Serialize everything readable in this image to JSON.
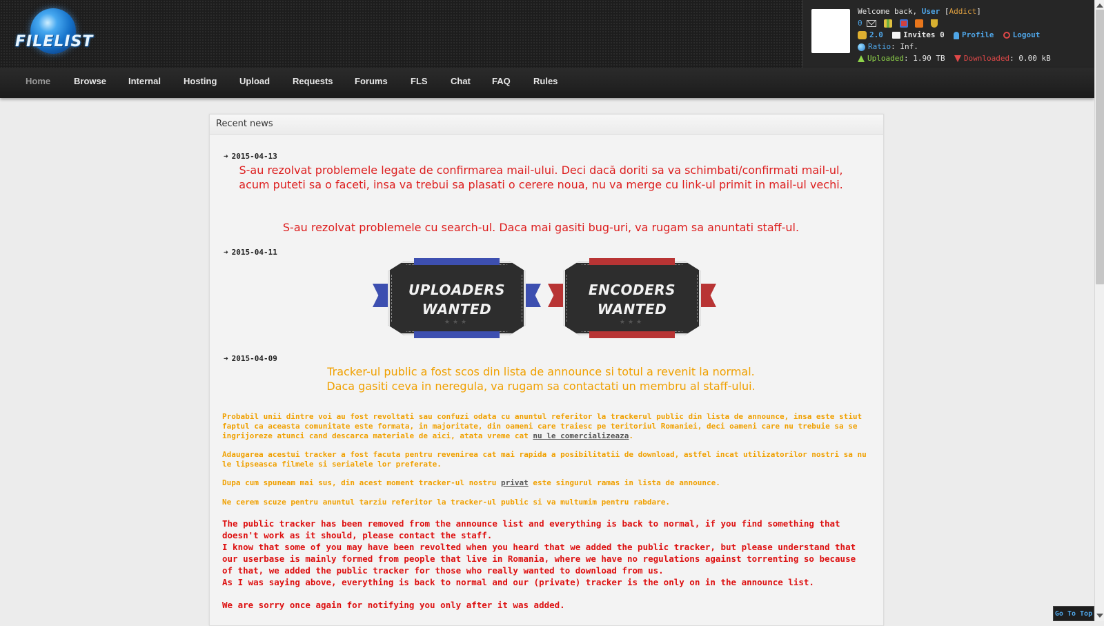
{
  "site": {
    "logo_text": "FILELIST"
  },
  "user": {
    "welcome": "Welcome back,",
    "name": "User",
    "class": "Addict",
    "messages_count": "0",
    "bonus": "2.0",
    "invites_label": "Invites 0",
    "profile_label": "Profile",
    "logout_label": "Logout",
    "ratio_label": "Ratio",
    "ratio_value": "Inf.",
    "uploaded_label": "Uploaded",
    "uploaded_value": "1.90 TB",
    "downloaded_label": "Downloaded",
    "downloaded_value": "0.00 kB"
  },
  "nav": {
    "items": [
      {
        "label": "Home",
        "active": true
      },
      {
        "label": "Browse"
      },
      {
        "label": "Internal"
      },
      {
        "label": "Hosting"
      },
      {
        "label": "Upload"
      },
      {
        "label": "Requests"
      },
      {
        "label": "Forums"
      },
      {
        "label": "FLS"
      },
      {
        "label": "Chat"
      },
      {
        "label": "FAQ"
      },
      {
        "label": "Rules"
      }
    ]
  },
  "news": {
    "title": "Recent news",
    "entries": [
      {
        "date": "2015-04-13",
        "text1": "S-au rezolvat problemele legate de confirmarea mail-ului. Deci dacă doriti sa va schimbati/confirmati mail-ul, acum puteti sa o faceti, insa va trebui sa plasati o cerere noua, nu va merge cu link-ul primit in mail-ul vechi.",
        "text2": "S-au rezolvat problemele cu search-ul. Daca mai gasiti bug-uri, va rugam sa anuntati staff-ul."
      },
      {
        "date": "2015-04-11",
        "banner1_line1": "UPLOADERS",
        "banner1_line2": "WANTED",
        "banner2_line1": "ENCODERS",
        "banner2_line2": "WANTED"
      },
      {
        "date": "2015-04-09",
        "headline1": "Tracker-ul public a fost scos din lista de announce si totul a revenit la normal.",
        "headline2": "Daca gasiti ceva in neregula, va rugam sa contactati un membru al staff-ului.",
        "p1": "Probabil unii dintre voi au fost revoltati sau confuzi odata cu anuntul referitor la trackerul public din lista de announce, insa este stiut faptul ca aceasta comunitate este formata, in majoritate, din oameni care traiesc pe teritoriul Romaniei, deci oameni care nu trebuie sa se ingrijoreze atunci cand descarca materiale de aici, atata vreme cat",
        "p1_link": "nu le comercializeaza",
        "p2": "Adaugarea acestui tracker a fost facuta pentru revenirea cat mai rapida a posibilitatii de download, astfel incat utilizatorilor nostri sa nu le lipseasca filmele si serialele lor preferate.",
        "p3_before": "Dupa cum spuneam mai sus, din acest moment tracker-ul nostru",
        "p3_link": "privat",
        "p3_after": "este singurul ramas in lista de announce.",
        "p4": "Ne cerem scuze pentru anuntul tarziu referitor la tracker-ul public si va multumim pentru rabdare.",
        "en1": "The public tracker has been removed from the announce list and everything is back to normal, if you find something that doesn't work as it should, please contact the staff.",
        "en2": "I know that some of you may have been revolted when you heard that we added the public tracker, but please understand that our userbase is mainly formed from people that live in Romania, where we have no regulations against torrenting so because of that, we added the public tracker for those who really wanted to download from us.",
        "en3": "As I was saying above, everything is back to normal and our (private) tracker is the only on in the announce list.",
        "en4": "We are sorry once again for notifying you only after it was added."
      }
    ]
  },
  "footer": {
    "goto_top": "Go To Top"
  },
  "colors": {
    "header_bg": "#1d1d1d",
    "accent_blue": "#4fa6e8",
    "news_red": "#dd1e1e",
    "news_orange": "#f0a000",
    "banner_blue": "#3d4fb0",
    "banner_red": "#b83434"
  }
}
